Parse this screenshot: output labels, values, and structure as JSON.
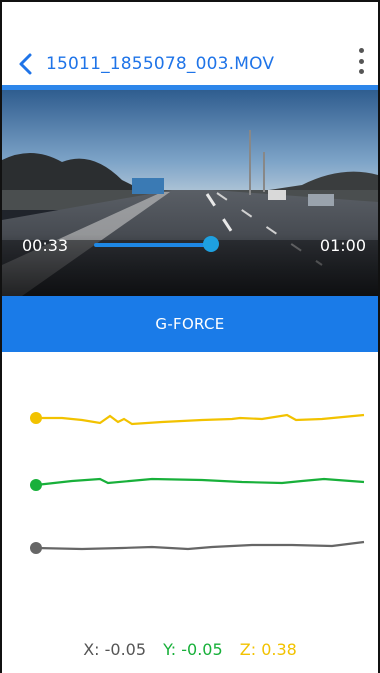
{
  "header": {
    "title": "15011_1855078_003.MOV",
    "back_icon": "chevron-left-icon",
    "menu_icon": "more-vertical-icon"
  },
  "player": {
    "current_time": "00:33",
    "total_time": "01:00",
    "progress": 0.55
  },
  "gforce": {
    "label": "G-FORCE"
  },
  "axes": {
    "x_label": "X: -0.05",
    "y_label": "Y: -0.05",
    "z_label": "Z: 0.38"
  },
  "colors": {
    "accent_blue": "#1a7be8",
    "z_yellow": "#f2c200",
    "y_green": "#18b03a",
    "x_gray": "#666666"
  }
}
